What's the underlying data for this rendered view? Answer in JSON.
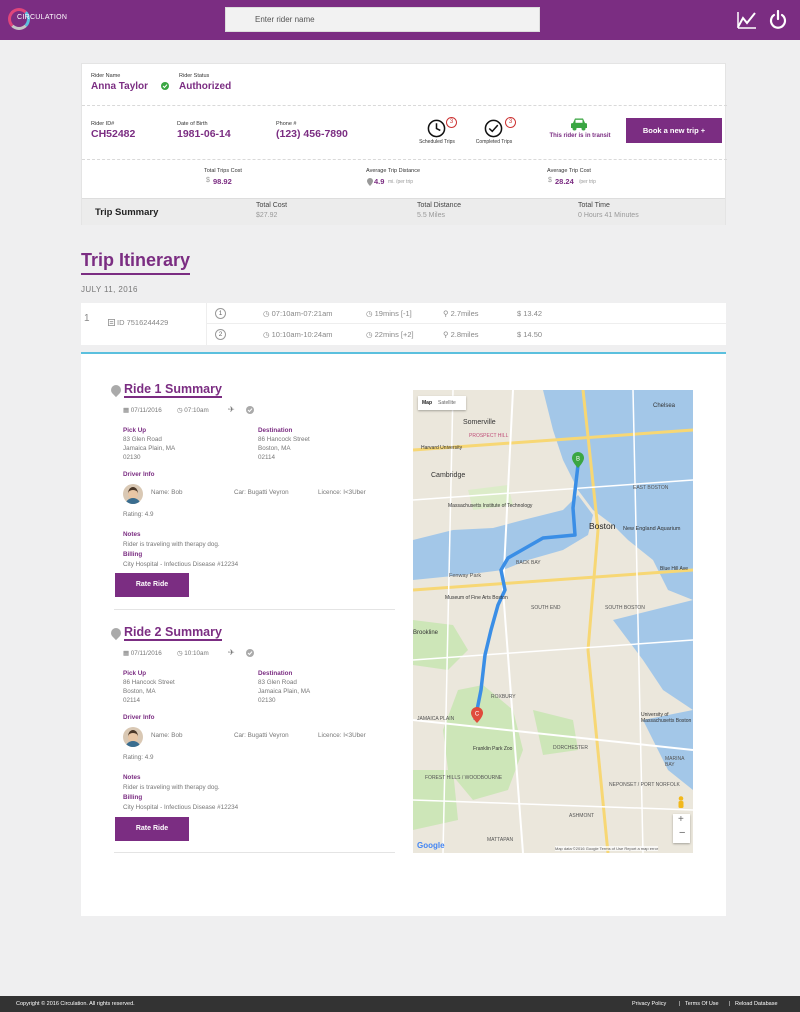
{
  "header": {
    "logo_text": "CIRCULATION",
    "search_placeholder": "Enter rider name",
    "chart_icon": "chart-icon",
    "power_icon": "power-icon"
  },
  "rider": {
    "name_label": "Rider Name",
    "name": "Anna Taylor",
    "status_label": "Rider Status",
    "status": "Authorized",
    "id_label": "Rider ID#",
    "id": "CH52482",
    "dob_label": "Date of Birth",
    "dob": "1981-06-14",
    "phone_label": "Phone #",
    "phone": "(123) 456-7890",
    "scheduled_count": "3",
    "scheduled_label": "Scheduled Trips",
    "completed_count": "3",
    "completed_label": "Completed Trips",
    "transit_text": "This rider is in transit",
    "book_button": "Book a new trip  +"
  },
  "stats": {
    "total_cost_label": "Total Trips Cost",
    "total_cost": "98.92",
    "avg_distance_label": "Average Trip Distance",
    "avg_distance": "4.9",
    "avg_distance_unit": "mi. /per trip",
    "avg_cost_label": "Average Trip Cost",
    "avg_cost": "28.24",
    "avg_cost_unit": "/per trip",
    "dollar": "$"
  },
  "trip_summary": {
    "title": "Trip Summary",
    "cost_label": "Total Cost",
    "cost": "$27.92",
    "distance_label": "Total Distance",
    "distance": "5.5 Miles",
    "time_label": "Total Time",
    "time": "0 Hours 41 Minutes"
  },
  "itinerary": {
    "title": "Trip Itinerary",
    "date": "JULY 11, 2016",
    "row_number": "1",
    "trip_id": "ID 7516244429",
    "legs": [
      {
        "n": "1",
        "time": "07:10am-07:21am",
        "duration": "19mins [-1]",
        "distance": "2.7miles",
        "cost": "13.42"
      },
      {
        "n": "2",
        "time": "10:10am-10:24am",
        "duration": "22mins [+2]",
        "distance": "2.8miles",
        "cost": "14.50"
      }
    ]
  },
  "rides": [
    {
      "title": "Ride 1 Summary",
      "date": "07/11/2016",
      "time": "07:10am",
      "pickup_label": "Pick Up",
      "pickup_1": "83 Glen Road",
      "pickup_2": "Jamaica Plain, MA",
      "pickup_3": "02130",
      "dest_label": "Destination",
      "dest_1": "86 Hancock Street",
      "dest_2": "Boston, MA",
      "dest_3": "02114",
      "driver_label": "Driver Info",
      "driver_name": "Name: Bob",
      "car": "Car: Bugatti Veyron",
      "licence": "Licence: I<3Uber",
      "rating": "Rating: 4.9",
      "notes_label": "Notes",
      "notes": "Rider is traveling with therapy dog.",
      "billing_label": "Billing",
      "billing": "City Hospital - Infectious Disease #12234",
      "rate_button": "Rate Ride"
    },
    {
      "title": "Ride 2 Summary",
      "date": "07/11/2016",
      "time": "10:10am",
      "pickup_label": "Pick Up",
      "pickup_1": "86 Hancock Street",
      "pickup_2": "Boston, MA",
      "pickup_3": "02114",
      "dest_label": "Destination",
      "dest_1": "83 Glen Road",
      "dest_2": "Jamaica Plain, MA",
      "dest_3": "02130",
      "driver_label": "Driver Info",
      "driver_name": "Name: Bob",
      "car": "Car: Bugatti Veyron",
      "licence": "Licence: I<3Uber",
      "rating": "Rating: 4.9",
      "notes_label": "Notes",
      "notes": "Rider is traveling with therapy dog.",
      "billing_label": "Billing",
      "billing": "City Hospital - Infectious Disease #12234",
      "rate_button": "Rate Ride"
    }
  ],
  "map": {
    "map_tab": "Map",
    "satellite_tab": "Satellite",
    "labels": [
      "Somerville",
      "Cambridge",
      "Boston",
      "Fenway Park",
      "SOUTH END",
      "ROXBURY",
      "JAMAICA PLAIN",
      "DORCHESTER",
      "Brookline",
      "MATTAPAN",
      "SOUTH BOSTON",
      "EAST BOSTON",
      "Chelsea",
      "PROSPECT HILL",
      "BACK BAY",
      "Harvard University",
      "Franklin Park Zoo",
      "FOREST HILLS / WOODBOURNE",
      "University of Massachusetts Boston",
      "ASHMONT",
      "NEPONSET / PORT NORFOLK",
      "Blue Hill Ave",
      "New England Aquarium",
      "Massachusetts Institute of Technology",
      "Museum of Fine Arts Boston",
      "MARINA BAY"
    ],
    "google": "Google",
    "attribution": "Map data ©2016 Google  Terms of Use  Report a map error"
  },
  "footer": {
    "copyright": "Copyright © 2016 Circulation. All rights reserved.",
    "privacy": "Privacy Policy",
    "terms": "Terms Of Use",
    "reload": "Reload Database"
  },
  "colors": {
    "brand": "#7b2d82",
    "accent": "#5bc0de",
    "transit": "#3aa642"
  }
}
